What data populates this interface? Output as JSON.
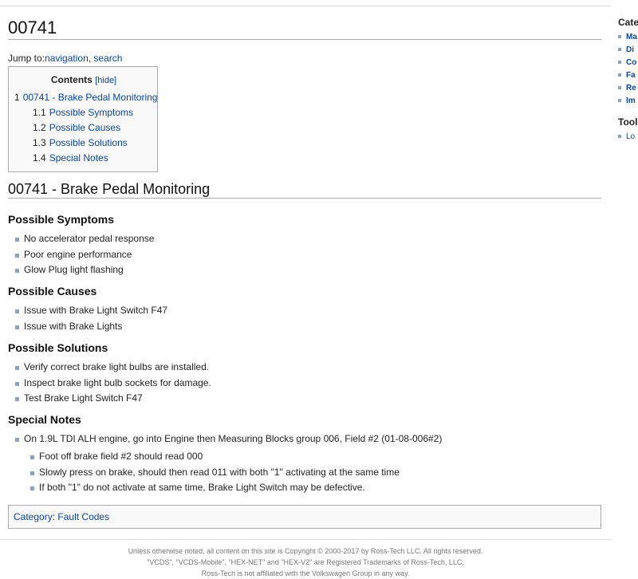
{
  "page": {
    "title": "00741",
    "jump_to_prefix": "Jump to:",
    "jump_navigation": "navigation",
    "jump_sep": ", ",
    "jump_search": "search"
  },
  "toc": {
    "title": "Contents",
    "hide_label": "[hide]",
    "items": [
      {
        "num": "1",
        "label": "00741 - Brake Pedal Monitoring"
      },
      {
        "num": "1.1",
        "label": "Possible Symptoms"
      },
      {
        "num": "1.2",
        "label": "Possible Causes"
      },
      {
        "num": "1.3",
        "label": "Possible Solutions"
      },
      {
        "num": "1.4",
        "label": "Special Notes"
      }
    ]
  },
  "content": {
    "section_title": "00741 - Brake Pedal Monitoring",
    "symptoms": {
      "heading": "Possible Symptoms",
      "items": [
        "No accelerator pedal response",
        "Poor engine performance",
        "Glow Plug light flashing"
      ]
    },
    "causes": {
      "heading": "Possible Causes",
      "items": [
        "Issue with Brake Light Switch F47",
        "Issue with Brake Lights"
      ]
    },
    "solutions": {
      "heading": "Possible Solutions",
      "items": [
        "Verify correct brake light bulbs are installed.",
        "Inspect brake light bulb sockets for damage.",
        "Test Brake Light Switch F47"
      ]
    },
    "notes": {
      "heading": "Special Notes",
      "main_item": "On 1.9L TDI ALH engine, go into Engine then Measuring Blocks group 006, Field #2 (01-08-006#2)",
      "sub_items": [
        "Foot off brake field #2 should read 000",
        "Slowly press on brake, should then read 011 with both \"1\" activating at the same time",
        "If both \"1\" do not activate at same time, Brake Light Switch may be defective."
      ]
    }
  },
  "category": {
    "prefix": "Category",
    "sep": ":",
    "link": "Fault Codes"
  },
  "footer": {
    "line1": "Unless otherwise noted, all content on this site is Copyright © 2000-2017 by Ross-Tech LLC. All rights reserved.",
    "line2": "\"VCDS\", \"VCDS-Mobile\", \"HEX-NET\" and \"HEX-V2\" are Registered Trademarks of Ross-Tech, LLC.",
    "line3": "Ross-Tech is not affiliated with the Volkswagen Group in any way."
  },
  "sidebar": {
    "categories_heading": "Cate",
    "category_items": [
      "Ma",
      "Di",
      "Co",
      "Fa",
      "Re",
      "Im"
    ],
    "tools_heading": "Tool",
    "tool_items": [
      "Lo"
    ]
  },
  "colors": {
    "link": "#0645ad",
    "bullet": "#8da0c0",
    "border": "#aaaaaa"
  }
}
